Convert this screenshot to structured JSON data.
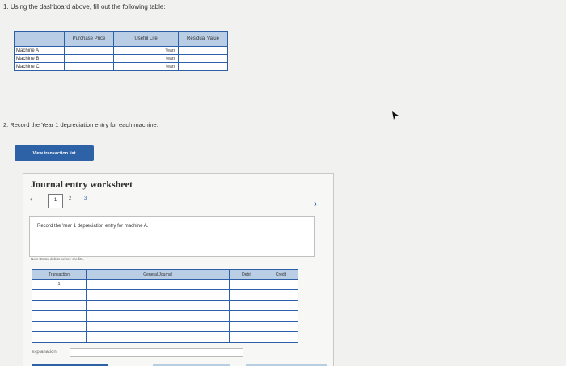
{
  "question1": "1. Using the dashboard above, fill out the following table:",
  "machine_table": {
    "headers": [
      "",
      "Purchase Price",
      "Useful Life",
      "Residual Value"
    ],
    "rows": [
      {
        "label": "Machine A",
        "unit": "Years"
      },
      {
        "label": "Machine B",
        "unit": "Years"
      },
      {
        "label": "Machine C",
        "unit": "Years"
      }
    ]
  },
  "question2": "2. Record the Year 1 depreciation entry for each machine:",
  "view_button": "View transaction list",
  "worksheet": {
    "title": "Journal entry worksheet",
    "pages": [
      "1",
      "2",
      "3"
    ],
    "instruction": "Record the Year 1 depreciation entry for machine A.",
    "note": "Note: Enter debits before credits.",
    "headers": [
      "Transaction",
      "General Journal",
      "Debit",
      "Credit"
    ],
    "rows": [
      {
        "transaction": "1"
      },
      {
        "transaction": ""
      },
      {
        "transaction": ""
      },
      {
        "transaction": ""
      },
      {
        "transaction": ""
      },
      {
        "transaction": ""
      }
    ],
    "explanation_label": "explanation"
  },
  "icons": {
    "prev": "chevron-left-icon",
    "next": "chevron-right-icon",
    "cursor": "mouse-pointer-icon"
  }
}
